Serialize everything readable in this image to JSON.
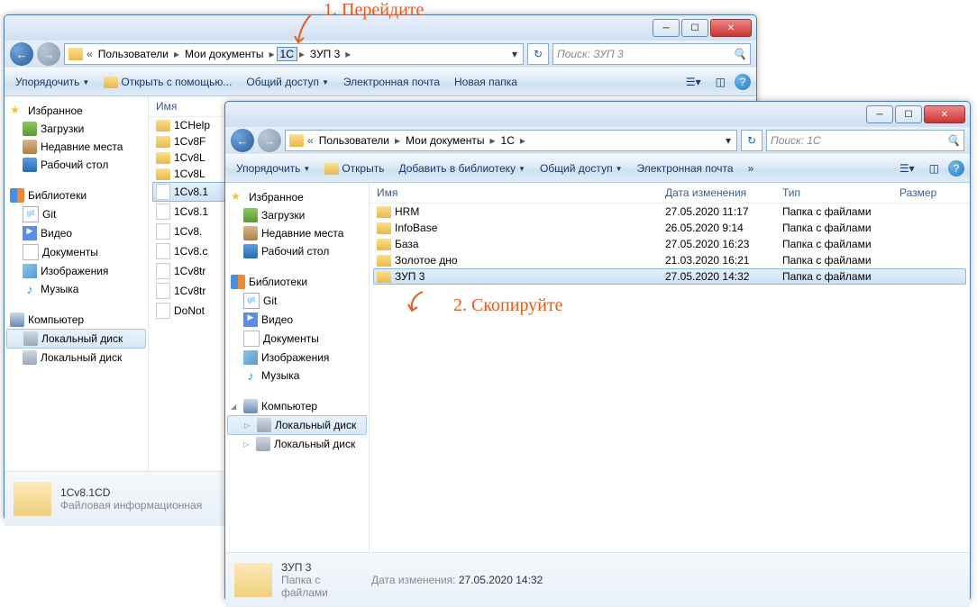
{
  "annotations": {
    "step1": "1. Перейдите",
    "step2": "2. Скопируйте"
  },
  "win1": {
    "breadcrumb": {
      "prefix": "«",
      "p1": "Пользователи",
      "p2": "Мои документы",
      "p3": "1C",
      "p4": "ЗУП 3"
    },
    "search": "Поиск: ЗУП 3",
    "toolbar": {
      "organize": "Упорядочить",
      "openwith": "Открыть с помощью...",
      "share": "Общий доступ",
      "email": "Электронная почта",
      "newfolder": "Новая папка"
    },
    "nav": {
      "fav": "Избранное",
      "downloads": "Загрузки",
      "recent": "Недавние места",
      "desktop": "Рабочий стол",
      "lib": "Библиотеки",
      "git": "Git",
      "video": "Видео",
      "docs": "Документы",
      "images": "Изображения",
      "music": "Музыка",
      "comp": "Компьютер",
      "disk1": "Локальный диск",
      "disk2": "Локальный диск"
    },
    "col_name": "Имя",
    "files": [
      {
        "name": "1CHelp"
      },
      {
        "name": "1Cv8F"
      },
      {
        "name": "1Cv8L"
      },
      {
        "name": "1Cv8L"
      },
      {
        "name": "1Cv8.1",
        "sel": true
      },
      {
        "name": "1Cv8.1"
      },
      {
        "name": "1Cv8."
      },
      {
        "name": "1Cv8.c"
      },
      {
        "name": "1Cv8tr"
      },
      {
        "name": "1Cv8tr"
      },
      {
        "name": "DoNot"
      }
    ],
    "details": {
      "title": "1Cv8.1CD",
      "sub": "Файловая информационная"
    }
  },
  "win2": {
    "breadcrumb": {
      "prefix": "«",
      "p1": "Пользователи",
      "p2": "Мои документы",
      "p3": "1C"
    },
    "search": "Поиск: 1C",
    "toolbar": {
      "organize": "Упорядочить",
      "open": "Открыть",
      "addlib": "Добавить в библиотеку",
      "share": "Общий доступ",
      "email": "Электронная почта"
    },
    "nav": {
      "fav": "Избранное",
      "downloads": "Загрузки",
      "recent": "Недавние места",
      "desktop": "Рабочий стол",
      "lib": "Библиотеки",
      "git": "Git",
      "video": "Видео",
      "docs": "Документы",
      "images": "Изображения",
      "music": "Музыка",
      "comp": "Компьютер",
      "disk1": "Локальный диск",
      "disk2": "Локальный диск"
    },
    "cols": {
      "name": "Имя",
      "date": "Дата изменения",
      "type": "Тип",
      "size": "Размер"
    },
    "files": [
      {
        "name": "HRM",
        "date": "27.05.2020 11:17",
        "type": "Папка с файлами"
      },
      {
        "name": "InfoBase",
        "date": "26.05.2020 9:14",
        "type": "Папка с файлами"
      },
      {
        "name": "База",
        "date": "27.05.2020 16:23",
        "type": "Папка с файлами"
      },
      {
        "name": "Золотое дно",
        "date": "21.03.2020 16:21",
        "type": "Папка с файлами"
      },
      {
        "name": "ЗУП 3",
        "date": "27.05.2020 14:32",
        "type": "Папка с файлами",
        "sel": true
      }
    ],
    "details": {
      "title": "ЗУП 3",
      "sub": "Папка с файлами",
      "date_lbl": "Дата изменения:",
      "date": "27.05.2020 14:32"
    }
  }
}
